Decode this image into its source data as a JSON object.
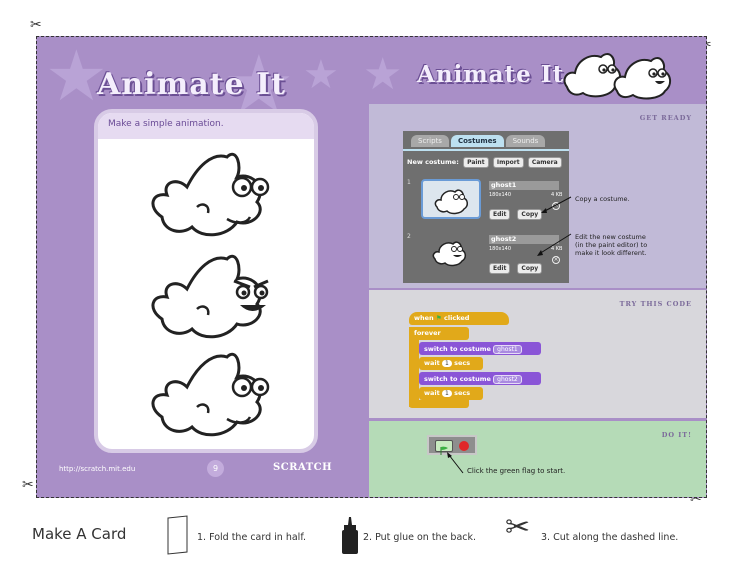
{
  "left_page": {
    "title": "Animate It",
    "subtitle": "Make a simple animation.",
    "footer_url": "http://scratch.mit.edu",
    "page_number": "9",
    "logo": "SCRATCH"
  },
  "right_page": {
    "title": "Animate It",
    "get_ready": {
      "label": "GET READY",
      "tabs": [
        "Scripts",
        "Costumes",
        "Sounds"
      ],
      "new_costume_label": "New costume:",
      "buttons": [
        "Paint",
        "Import",
        "Camera"
      ],
      "costumes": [
        {
          "num": "1",
          "name": "ghost1",
          "dims": "180x140",
          "size": "4 KB",
          "edit": "Edit",
          "copy": "Copy",
          "close": "×"
        },
        {
          "num": "2",
          "name": "ghost2",
          "dims": "180x140",
          "size": "4 KB",
          "edit": "Edit",
          "copy": "Copy",
          "close": "×"
        }
      ],
      "note_copy": "Copy a costume.",
      "note_edit_1": "Edit the new costume",
      "note_edit_2": "(in the paint editor) to",
      "note_edit_3": "make it look different."
    },
    "try_code": {
      "label": "TRY THIS CODE",
      "when": "when",
      "clicked": "clicked",
      "forever": "forever",
      "switch1": "switch to costume",
      "costume1": "ghost1",
      "wait": "wait",
      "secs_val": "1",
      "secs": "secs",
      "switch2": "switch to costume",
      "costume2": "ghost2"
    },
    "do_it": {
      "label": "DO IT!",
      "note": "Click the green flag to start."
    }
  },
  "instructions": {
    "make_card": "Make A Card",
    "step1": "1. Fold the card in half.",
    "step2": "2. Put glue on the back.",
    "step3": "3. Cut along the dashed line."
  },
  "colors": {
    "purple": "#a98fc7",
    "green_section": "#b5dbb7",
    "control_block": "#e1a91a",
    "looks_block": "#8a55d7"
  }
}
